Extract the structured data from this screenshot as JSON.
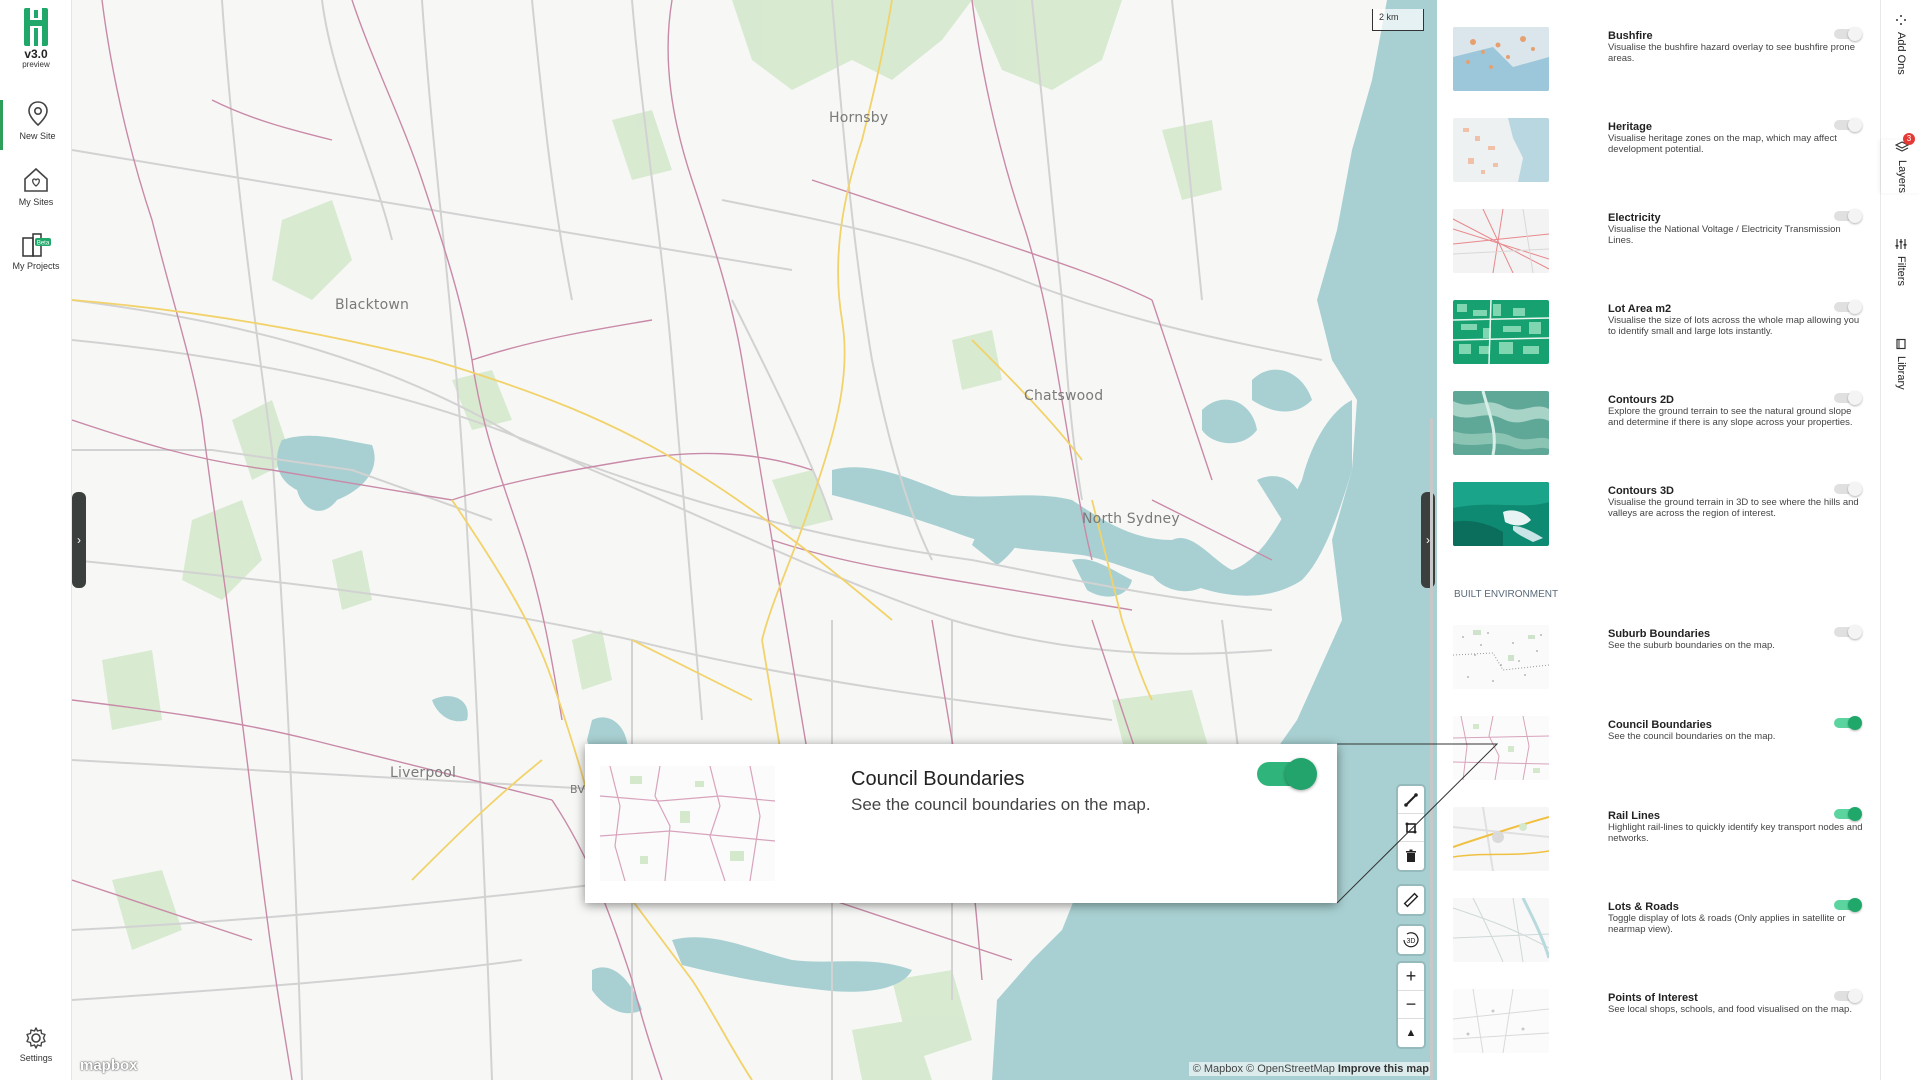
{
  "app": {
    "logo_version": "v3.0",
    "logo_sub": "preview",
    "brand_color": "#1fa86a"
  },
  "leftnav": {
    "items": [
      {
        "label": "New Site",
        "icon": "location-pin-icon"
      },
      {
        "label": "My Sites",
        "icon": "house-heart-icon"
      },
      {
        "label": "My Projects",
        "icon": "buildings-icon",
        "badge": "Beta"
      },
      {
        "label": "Settings",
        "icon": "gear-icon"
      }
    ]
  },
  "map": {
    "places": [
      "Hornsby",
      "Blacktown",
      "Chatswood",
      "North Sydney",
      "Liverpool",
      "BV"
    ],
    "scale_label": "2 km",
    "attribution": {
      "text": "© Mapbox © OpenStreetMap",
      "link": "Improve this map"
    },
    "mapbox_logo": "mapbox",
    "controls": {
      "three_d_label": "3D",
      "plus": "+",
      "minus": "−",
      "north": "▲"
    }
  },
  "callout": {
    "title": "Council Boundaries",
    "description": "See the council boundaries on the map.",
    "enabled": true
  },
  "panel": {
    "section_built": "BUILT ENVIRONMENT",
    "layers": [
      {
        "name": "Bushfire",
        "description": "Visualise the bushfire hazard overlay to see bushfire prone areas.",
        "enabled": false
      },
      {
        "name": "Heritage",
        "description": "Visualise heritage zones on the map, which may affect development potential.",
        "enabled": false
      },
      {
        "name": "Electricity",
        "description": "Visualise the National Voltage / Electricity Transmission Lines.",
        "enabled": false
      },
      {
        "name": "Lot Area m2",
        "description": "Visualise the size of lots across the whole map allowing you to identify small and large lots instantly.",
        "enabled": false
      },
      {
        "name": "Contours 2D",
        "description": "Explore the ground terrain to see the natural ground slope and determine if there is any slope across your properties.",
        "enabled": false
      },
      {
        "name": "Contours 3D",
        "description": "Visualise the ground terrain in 3D to see where the hills and valleys are across the region of interest.",
        "enabled": false
      },
      {
        "name": "Suburb Boundaries",
        "description": "See the suburb boundaries on the map.",
        "enabled": false
      },
      {
        "name": "Council Boundaries",
        "description": "See the council boundaries on the map.",
        "enabled": true
      },
      {
        "name": "Rail Lines",
        "description": "Highlight rail-lines to quickly identify key transport nodes and networks.",
        "enabled": true
      },
      {
        "name": "Lots & Roads",
        "description": "Toggle display of lots & roads (Only applies in satellite or nearmap view).",
        "enabled": true
      },
      {
        "name": "Points of Interest",
        "description": "See local shops, schools, and food visualised on the map.",
        "enabled": false
      }
    ]
  },
  "vtabs": [
    {
      "label": "Add Ons",
      "icon": "grid-dots-icon"
    },
    {
      "label": "Layers",
      "icon": "layers-icon",
      "badge": "3"
    },
    {
      "label": "Filters",
      "icon": "sliders-icon"
    },
    {
      "label": "Library",
      "icon": "book-icon"
    }
  ]
}
